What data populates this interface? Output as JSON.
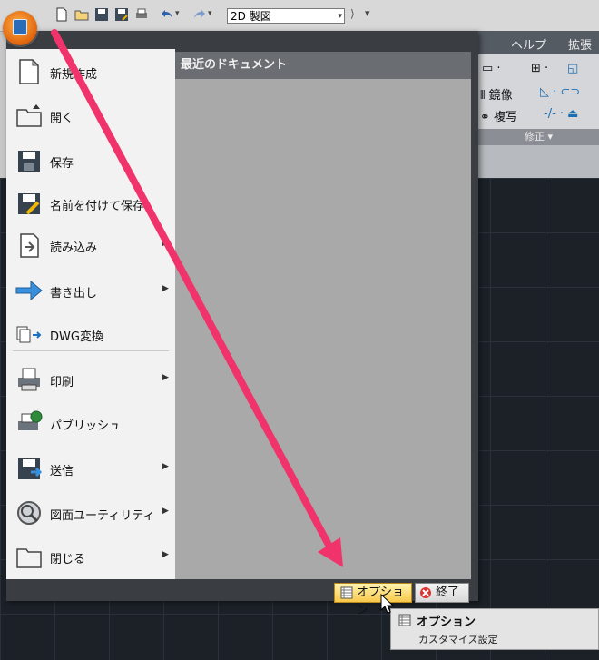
{
  "qat": {
    "workspace": "2D 製図"
  },
  "ribbon": {
    "tabs": [
      "ヘルプ",
      "拡張"
    ],
    "tools": [
      {
        "label": "鏡像"
      },
      {
        "label": "複写"
      }
    ],
    "panel_title": "修正"
  },
  "menu": {
    "items": [
      {
        "label": "新規作成",
        "icon": "new-document-icon",
        "submenu": false
      },
      {
        "label": "開く",
        "icon": "open-folder-icon",
        "submenu": false
      },
      {
        "label": "保存",
        "icon": "save-disk-icon",
        "submenu": false
      },
      {
        "label": "名前を付けて保存",
        "icon": "save-as-icon",
        "submenu": false
      },
      {
        "label": "読み込み",
        "icon": "import-icon",
        "submenu": true
      },
      {
        "label": "書き出し",
        "icon": "export-arrow-icon",
        "submenu": true
      },
      {
        "label": "DWG変換",
        "icon": "dwg-convert-icon",
        "submenu": false
      },
      {
        "label": "印刷",
        "icon": "printer-icon",
        "submenu": true
      },
      {
        "label": "パブリッシュ",
        "icon": "publish-icon",
        "submenu": false
      },
      {
        "label": "送信",
        "icon": "send-icon",
        "submenu": true
      },
      {
        "label": "図面ユーティリティ",
        "icon": "drawing-utilities-icon",
        "submenu": true
      },
      {
        "label": "閉じる",
        "icon": "close-folder-icon",
        "submenu": true
      }
    ],
    "recent_header": "最近のドキュメント",
    "options_label": "オプション",
    "exit_label": "終了"
  },
  "tooltip": {
    "title": "オプション",
    "description": "カスタマイズ設定"
  },
  "colors": {
    "annotation_arrow": "#f0336a",
    "options_highlight": "#f7c94c"
  }
}
